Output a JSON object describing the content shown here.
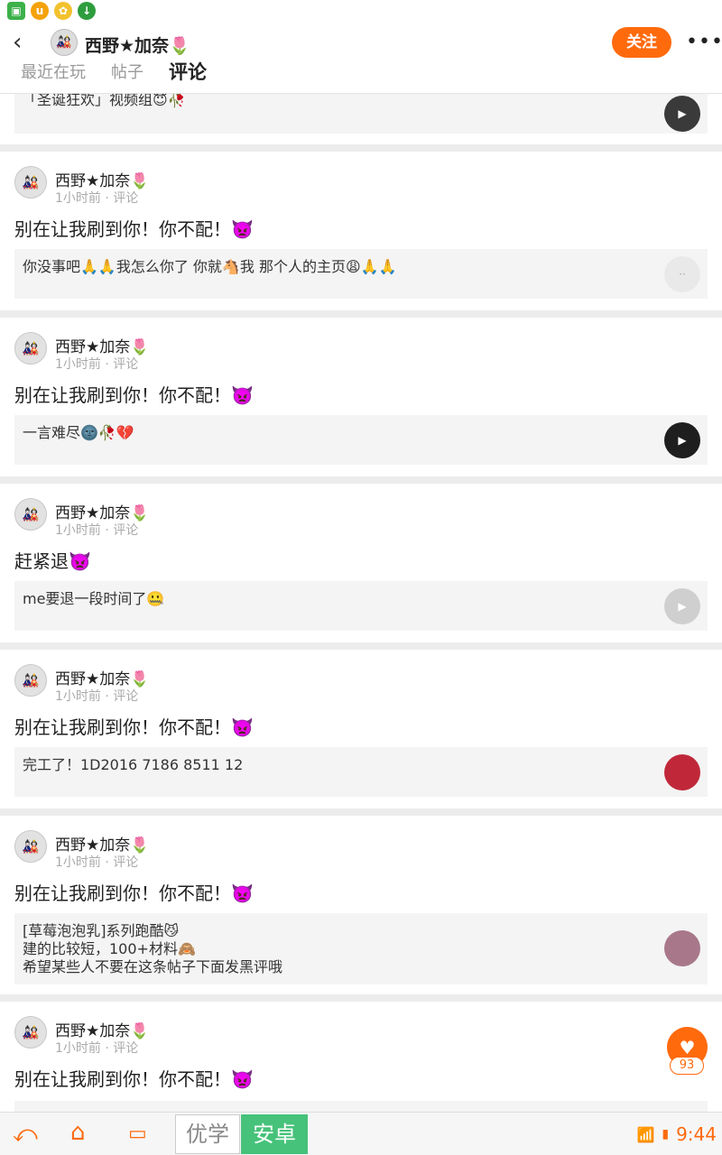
{
  "status_bar": {
    "icons": [
      "gallery-icon",
      "uc-icon",
      "settings-icon",
      "download-icon"
    ],
    "time": "9:44"
  },
  "header": {
    "back_icon": "‹",
    "user_name": "西野★加奈🌷",
    "follow_label": "关注",
    "more_icon": "•••",
    "tabs": [
      {
        "label": "最近在玩"
      },
      {
        "label": "帖子"
      },
      {
        "label": "评论"
      }
    ]
  },
  "top_partial": {
    "quote_text": "「圣诞狂欢」视频组😇🥀"
  },
  "posts": [
    {
      "name": "西野★加奈🌷",
      "meta": "1小时前 · 评论",
      "text": "别在让我刷到你！你不配！👿",
      "quote": "你没事吧🙏🙏我怎么你了 你就🐴我 那个人的主页😩🙏🙏"
    },
    {
      "name": "西野★加奈🌷",
      "meta": "1小时前 · 评论",
      "text": "别在让我刷到你！你不配！👿",
      "quote": "一言难尽🌚🥀💔"
    },
    {
      "name": "西野★加奈🌷",
      "meta": "1小时前 · 评论",
      "text": "赶紧退👿",
      "quote": "me要退一段时间了🤐"
    },
    {
      "name": "西野★加奈🌷",
      "meta": "1小时前 · 评论",
      "text": "别在让我刷到你！你不配！👿",
      "quote": "完工了！1D2016 7186 8511 12"
    },
    {
      "name": "西野★加奈🌷",
      "meta": "1小时前 · 评论",
      "text": "别在让我刷到你！你不配！👿",
      "quote": "[草莓泡泡乳]系列跑酷😼\n建的比较短，100+材料🙈\n希望某些人不要在这条帖子下面发黑评哦"
    },
    {
      "name": "西野★加奈🌷",
      "meta": "1小时前 · 评论",
      "text": "别在让我刷到你！你不配！👿",
      "quote": ""
    }
  ],
  "like": {
    "icon": "heart-icon",
    "count": "93"
  },
  "nav": {
    "brand_a": "优学",
    "brand_b": "安卓",
    "time": "9:44"
  },
  "colors": {
    "accent": "#ff6a0d",
    "brand_green": "#46c27a"
  }
}
